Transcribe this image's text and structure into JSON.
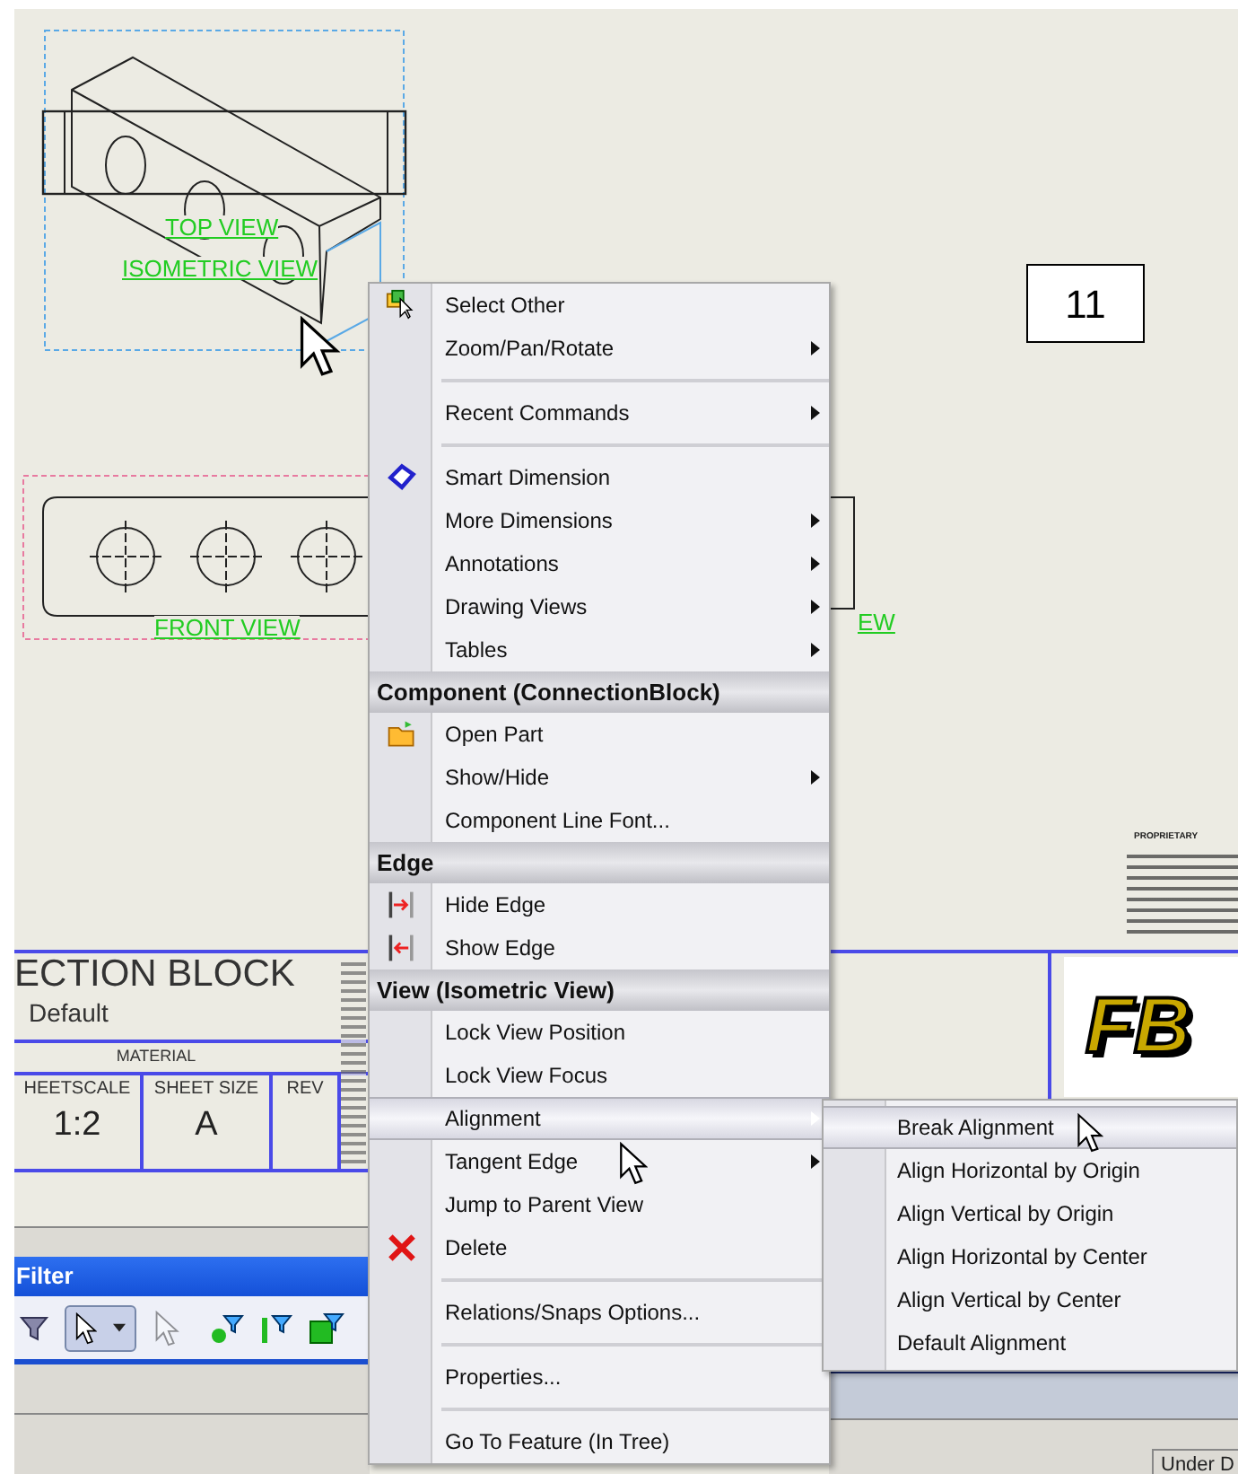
{
  "sheet": {
    "page_number": "11",
    "view_labels": [
      "TOP VIEW",
      "ISOMETRIC VIEW",
      "FRONT VIEW",
      "EW"
    ]
  },
  "title_block": {
    "title": "ECTION BLOCK",
    "configuration": "Default",
    "material_label": "MATERIAL",
    "sheet_scale_label": "HEETSCALE",
    "sheet_scale": "1:2",
    "sheet_size_label": "SHEET SIZE",
    "sheet_size": "A",
    "rev_label": "REV",
    "proprietary_heading": "PROPRIETARY",
    "logo": "FB"
  },
  "filter_toolbar": {
    "title": "Filter"
  },
  "status_bar": {
    "text": "Under D"
  },
  "context_menu": {
    "items": [
      {
        "kind": "item",
        "label": "Select Other",
        "submenu": false,
        "selected": false
      },
      {
        "kind": "item",
        "label": "Zoom/Pan/Rotate",
        "submenu": true,
        "selected": false
      },
      {
        "kind": "separator"
      },
      {
        "kind": "item",
        "label": "Recent Commands",
        "submenu": true,
        "selected": false
      },
      {
        "kind": "separator"
      },
      {
        "kind": "item",
        "label": "Smart Dimension",
        "submenu": false,
        "selected": false
      },
      {
        "kind": "item",
        "label": "More Dimensions",
        "submenu": true,
        "selected": false
      },
      {
        "kind": "item",
        "label": "Annotations",
        "submenu": true,
        "selected": false
      },
      {
        "kind": "item",
        "label": "Drawing Views",
        "submenu": true,
        "selected": false
      },
      {
        "kind": "item",
        "label": "Tables",
        "submenu": true,
        "selected": false
      },
      {
        "kind": "header",
        "label": "Component (ConnectionBlock)"
      },
      {
        "kind": "item",
        "label": "Open Part",
        "submenu": false,
        "selected": false
      },
      {
        "kind": "item",
        "label": "Show/Hide",
        "submenu": true,
        "selected": false
      },
      {
        "kind": "item",
        "label": "Component Line Font...",
        "submenu": false,
        "selected": false
      },
      {
        "kind": "header",
        "label": "Edge"
      },
      {
        "kind": "item",
        "label": "Hide Edge",
        "submenu": false,
        "selected": false
      },
      {
        "kind": "item",
        "label": "Show Edge",
        "submenu": false,
        "selected": false
      },
      {
        "kind": "header",
        "label": "View (Isometric View)"
      },
      {
        "kind": "item",
        "label": "Lock View Position",
        "submenu": false,
        "selected": false
      },
      {
        "kind": "item",
        "label": "Lock View Focus",
        "submenu": false,
        "selected": false
      },
      {
        "kind": "item",
        "label": "Alignment",
        "submenu": true,
        "selected": true
      },
      {
        "kind": "item",
        "label": "Tangent Edge",
        "submenu": true,
        "selected": false
      },
      {
        "kind": "item",
        "label": "Jump to Parent View",
        "submenu": false,
        "selected": false
      },
      {
        "kind": "item",
        "label": "Delete",
        "submenu": false,
        "selected": false
      },
      {
        "kind": "separator"
      },
      {
        "kind": "item",
        "label": "Relations/Snaps Options...",
        "submenu": false,
        "selected": false
      },
      {
        "kind": "separator"
      },
      {
        "kind": "item",
        "label": "Properties...",
        "submenu": false,
        "selected": false
      },
      {
        "kind": "separator"
      },
      {
        "kind": "item",
        "label": "Go To Feature (In Tree)",
        "submenu": false,
        "selected": false
      }
    ]
  },
  "submenu": {
    "items": [
      {
        "label": "Break Alignment",
        "selected": true
      },
      {
        "label": "Align Horizontal by Origin",
        "selected": false
      },
      {
        "label": "Align Vertical by Origin",
        "selected": false
      },
      {
        "label": "Align Horizontal by Center",
        "selected": false
      },
      {
        "label": "Align Vertical by Center",
        "selected": false
      },
      {
        "label": "Default Alignment",
        "selected": false
      }
    ]
  }
}
